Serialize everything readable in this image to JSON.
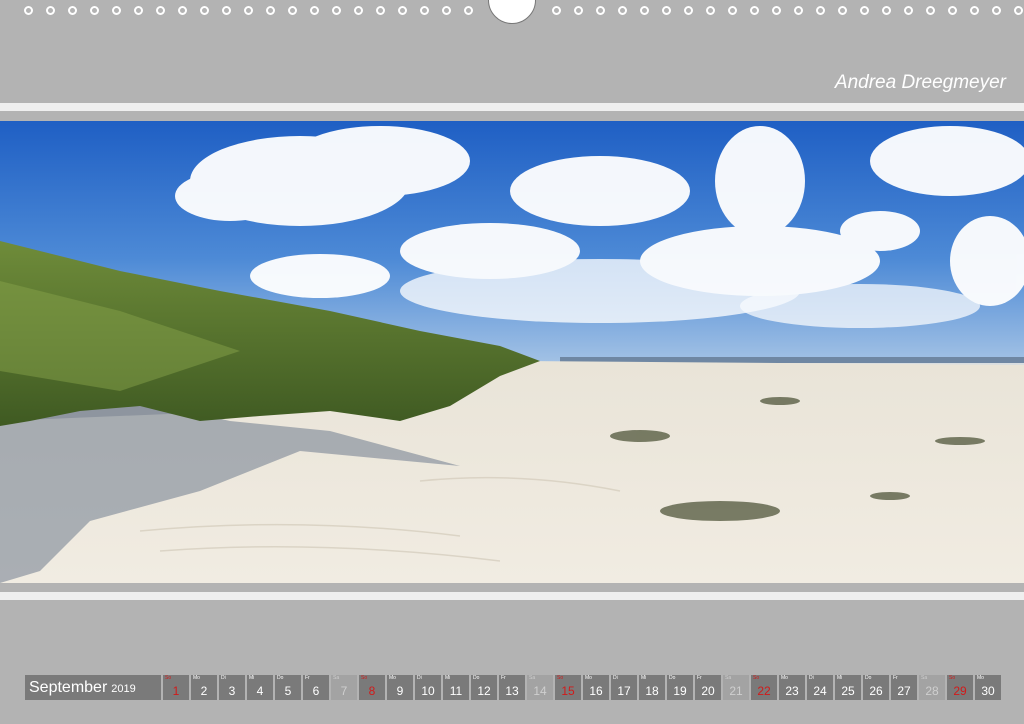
{
  "author": "Andrea Dreegmeyer",
  "calendar": {
    "month": "September",
    "year": "2019",
    "days": [
      {
        "wd": "So",
        "num": "1",
        "type": "sun"
      },
      {
        "wd": "Mo",
        "num": "2",
        "type": "week"
      },
      {
        "wd": "Di",
        "num": "3",
        "type": "week"
      },
      {
        "wd": "Mi",
        "num": "4",
        "type": "week"
      },
      {
        "wd": "Do",
        "num": "5",
        "type": "week"
      },
      {
        "wd": "Fr",
        "num": "6",
        "type": "week"
      },
      {
        "wd": "Sa",
        "num": "7",
        "type": "sat"
      },
      {
        "wd": "So",
        "num": "8",
        "type": "sun"
      },
      {
        "wd": "Mo",
        "num": "9",
        "type": "week"
      },
      {
        "wd": "Di",
        "num": "10",
        "type": "week"
      },
      {
        "wd": "Mi",
        "num": "11",
        "type": "week"
      },
      {
        "wd": "Do",
        "num": "12",
        "type": "week"
      },
      {
        "wd": "Fr",
        "num": "13",
        "type": "week"
      },
      {
        "wd": "Sa",
        "num": "14",
        "type": "sat"
      },
      {
        "wd": "So",
        "num": "15",
        "type": "sun"
      },
      {
        "wd": "Mo",
        "num": "16",
        "type": "week"
      },
      {
        "wd": "Di",
        "num": "17",
        "type": "week"
      },
      {
        "wd": "Mi",
        "num": "18",
        "type": "week"
      },
      {
        "wd": "Do",
        "num": "19",
        "type": "week"
      },
      {
        "wd": "Fr",
        "num": "20",
        "type": "week"
      },
      {
        "wd": "Sa",
        "num": "21",
        "type": "sat"
      },
      {
        "wd": "So",
        "num": "22",
        "type": "sun"
      },
      {
        "wd": "Mo",
        "num": "23",
        "type": "week"
      },
      {
        "wd": "Di",
        "num": "24",
        "type": "week"
      },
      {
        "wd": "Mi",
        "num": "25",
        "type": "week"
      },
      {
        "wd": "Do",
        "num": "26",
        "type": "week"
      },
      {
        "wd": "Fr",
        "num": "27",
        "type": "week"
      },
      {
        "wd": "Sa",
        "num": "28",
        "type": "sat"
      },
      {
        "wd": "So",
        "num": "29",
        "type": "sun"
      },
      {
        "wd": "Mo",
        "num": "30",
        "type": "week"
      }
    ]
  },
  "photo": {
    "subject": "beach-dunes-panorama"
  }
}
